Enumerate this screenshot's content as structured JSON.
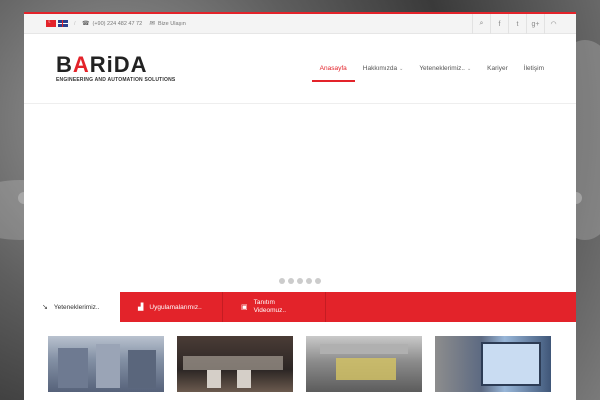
{
  "topbar": {
    "phone": "(+90) 224 482 47 72",
    "contact": "Bize Ulaşın",
    "social_icons": [
      "search-icon",
      "facebook-icon",
      "twitter-icon",
      "google-plus-icon",
      "rss-icon"
    ]
  },
  "logo": {
    "name": "BARiDA",
    "tagline": "ENGINEERING AND AUTOMATION SOLUTIONS"
  },
  "nav": {
    "items": [
      {
        "label": "Anasayfa"
      },
      {
        "label": "Hakkımızda"
      },
      {
        "label": "Yeteneklerimiz.."
      },
      {
        "label": "Kariyer"
      },
      {
        "label": "İletişim"
      }
    ]
  },
  "tabs": {
    "items": [
      {
        "label": "Yeteneklerimiz.."
      },
      {
        "label": "Uygulamalarımız.."
      },
      {
        "label_line1": "Tanıtım",
        "label_line2": "Videomuz.."
      }
    ]
  },
  "colors": {
    "accent": "#e3232a",
    "text": "#555555"
  }
}
